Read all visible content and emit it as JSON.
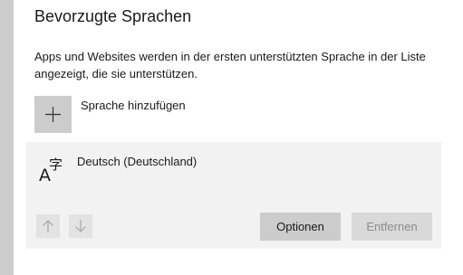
{
  "section": {
    "title": "Bevorzugte Sprachen",
    "description": "Apps und Websites werden in der ersten unterstützten Sprache in der Liste angezeigt, die sie unterstützen."
  },
  "add_language": {
    "label": "Sprache hinzufügen",
    "icon": "plus-icon"
  },
  "languages": [
    {
      "name": "Deutsch (Deutschland)",
      "icon": "language-icon",
      "icon_glyphs": {
        "latin": "A",
        "cjk": "字"
      },
      "move_up_icon": "arrow-up-icon",
      "move_down_icon": "arrow-down-icon",
      "options_label": "Optionen",
      "remove_label": "Entfernen",
      "remove_enabled": false
    }
  ]
}
